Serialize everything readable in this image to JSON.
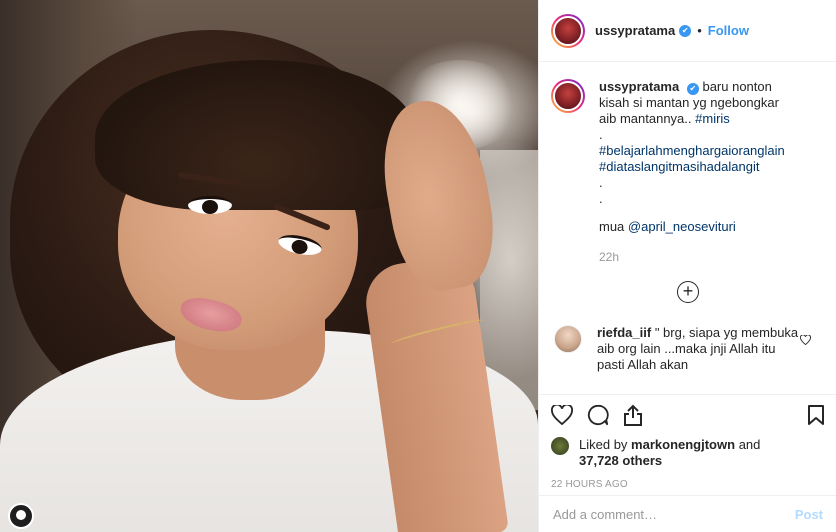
{
  "post": {
    "username": "ussypratama",
    "follow_label": "Follow",
    "dot": "•",
    "verified_mark": "✔"
  },
  "caption": {
    "username": "ussypratama",
    "text_before_tag": "baru nonton kisah si mantan yg ngebongkar aib mantannya..",
    "tag_1": "#miris",
    "dot_lines": ".",
    "tag_2": "#belajarlahmenghargaioranglain",
    "tag_3": "#diataslangitmasihadalangit",
    "mua_label": "mua",
    "mua_mention": "@april_neosevituri",
    "time": "22h"
  },
  "load_more_icon": "+",
  "comments": [
    {
      "username": "riefda_iif",
      "text": "\" brg, siapa yg membuka aib org lain ...maka jnji Allah itu pasti Allah akan",
      "icon": "heart-outline-icon"
    }
  ],
  "actions": {
    "icons": [
      "heart-icon",
      "comment-icon",
      "share-icon",
      "bookmark-icon"
    ]
  },
  "likes": {
    "prefix": "Liked by",
    "user": "markonengjtown",
    "and": "and",
    "count": "37,728 others"
  },
  "timestamp": "22 HOURS AGO",
  "add_comment": {
    "placeholder": "Add a comment…",
    "post_label": "Post"
  },
  "colors": {
    "accent": "#3897f0",
    "hashtag": "#003569",
    "muted": "#999999",
    "post_disabled": "#b3dbff"
  }
}
